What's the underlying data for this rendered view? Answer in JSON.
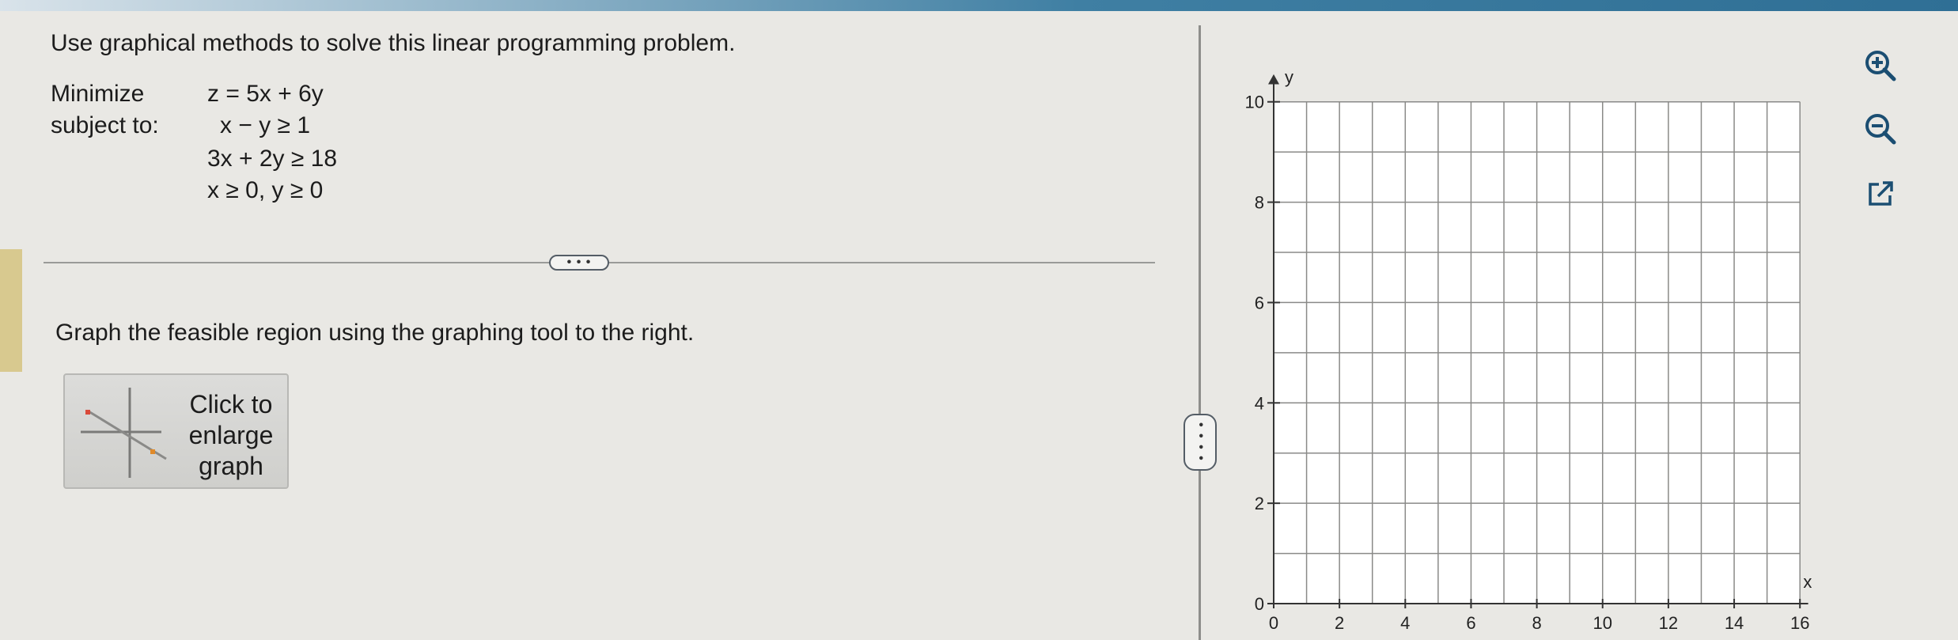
{
  "problem": {
    "instruction": "Use graphical methods to solve this linear programming problem.",
    "minimize_label": "Minimize",
    "subject_to_label": "subject to:",
    "objective": "z = 5x + 6y",
    "constraints": [
      "x −  y ≥ 1",
      "3x + 2y ≥ 18",
      "x ≥ 0, y ≥ 0"
    ]
  },
  "divider": {
    "more_label": "• • •"
  },
  "graph_task": {
    "instruction": "Graph the feasible region using the graphing tool to the right.",
    "enlarge_button_label": [
      "Click to",
      "enlarge",
      "graph"
    ]
  },
  "splitter": {
    "handle_label": "• • • •"
  },
  "graph": {
    "x_axis_label": "x",
    "y_axis_label": "y",
    "x_ticks": [
      "0",
      "2",
      "4",
      "6",
      "8",
      "10",
      "12",
      "14",
      "16"
    ],
    "y_ticks": [
      "0",
      "2",
      "4",
      "6",
      "8",
      "10"
    ],
    "x_range": [
      0,
      16.5
    ],
    "y_range": [
      0,
      10.5
    ]
  },
  "tools": {
    "zoom_in_icon": "zoom-in-icon",
    "zoom_out_icon": "zoom-out-icon",
    "popout_icon": "external-link-icon"
  },
  "colors": {
    "top_bar": "#2f6f95",
    "left_accent": "#d8c98f",
    "grid_line": "#8a8a88",
    "thumb_red": "#d94a3a",
    "thumb_orange": "#e08a2a"
  }
}
